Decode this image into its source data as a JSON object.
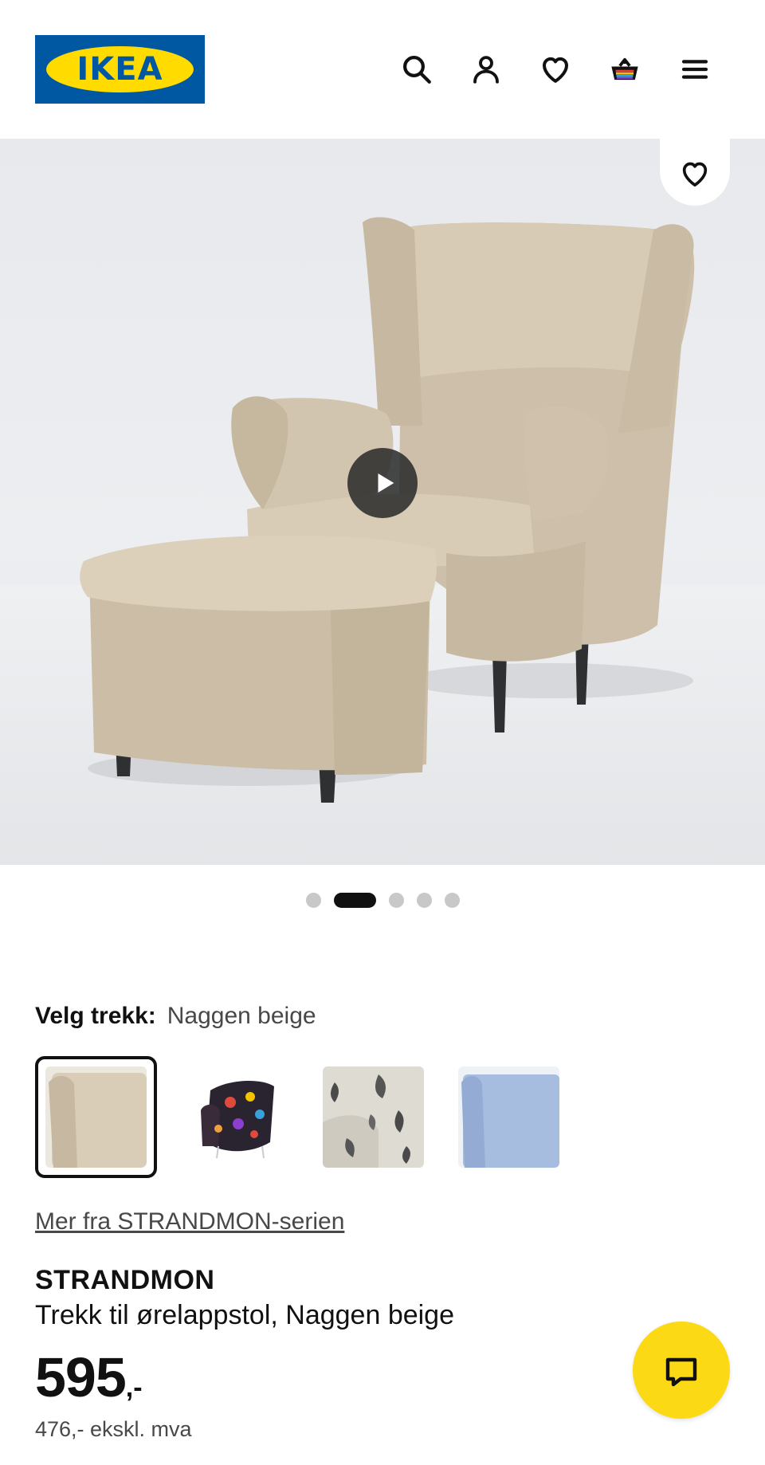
{
  "header": {
    "logo_text": "IKEA",
    "icons": [
      "search-icon",
      "account-icon",
      "favourites-icon",
      "cart-icon",
      "menu-icon"
    ]
  },
  "gallery": {
    "dots_total": 5,
    "active_dot": 2,
    "icons": [
      "heart-icon",
      "play-icon"
    ]
  },
  "variant": {
    "label": "Velg trekk:",
    "value": "Naggen beige",
    "options": [
      "Naggen beige",
      "floral",
      "grey pattern",
      "light blue"
    ]
  },
  "series_link": "Mer fra STRANDMON-serien",
  "product": {
    "name": "STRANDMON",
    "description": "Trekk til ørelappstol, Naggen beige",
    "price_integer": "595",
    "price_decimal": ",-",
    "price_ex_vat": "476,- ekskl. mva"
  },
  "colors": {
    "brand_blue": "#0058a3",
    "brand_yellow": "#ffdb00",
    "chat_yellow": "#fbd914",
    "text_primary": "#111111",
    "text_secondary": "#484848"
  },
  "chat": {
    "icon": "chat-icon"
  }
}
